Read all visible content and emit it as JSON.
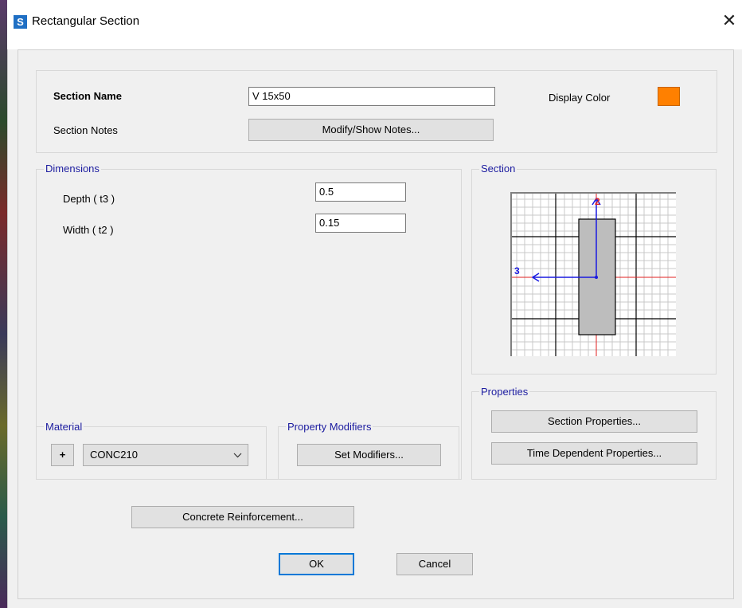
{
  "window": {
    "title": "Rectangular Section",
    "app_icon_letter": "S",
    "close_glyph": "✕"
  },
  "header": {
    "section_name_label": "Section Name",
    "section_name_value": "V 15x50",
    "section_notes_label": "Section Notes",
    "modify_notes_button": "Modify/Show Notes...",
    "display_color_label": "Display Color",
    "display_color": "#ff8000"
  },
  "dimensions": {
    "group_label": "Dimensions",
    "depth_label": "Depth  ( t3 )",
    "depth_value": "0.5",
    "width_label": "Width  ( t2 )",
    "width_value": "0.15"
  },
  "section_preview": {
    "group_label": "Section",
    "axis_2_label": "2",
    "axis_3_label": "3"
  },
  "properties": {
    "group_label": "Properties",
    "section_properties_button": "Section Properties...",
    "time_dependent_button": "Time Dependent Properties..."
  },
  "material": {
    "group_label": "Material",
    "add_button": "+",
    "selected": "CONC210"
  },
  "property_modifiers": {
    "group_label": "Property Modifiers",
    "set_modifiers_button": "Set Modifiers..."
  },
  "footer": {
    "concrete_reinforcement_button": "Concrete Reinforcement...",
    "ok_button": "OK",
    "cancel_button": "Cancel"
  }
}
